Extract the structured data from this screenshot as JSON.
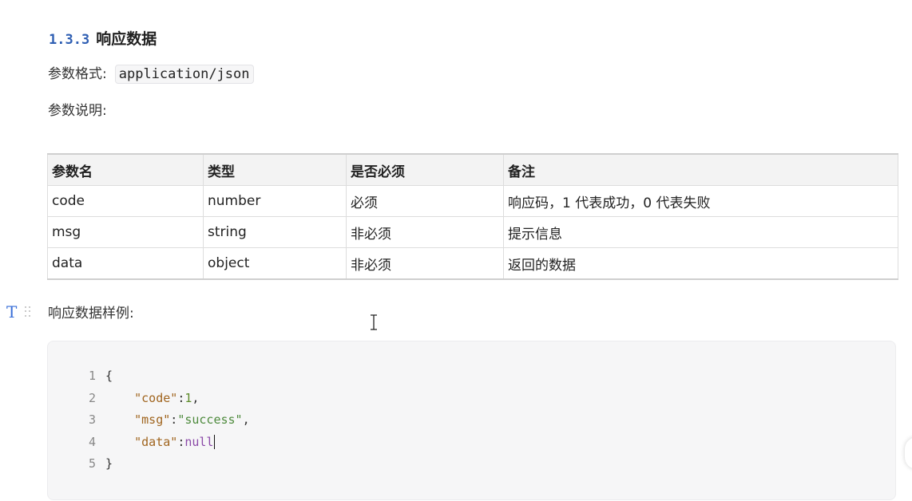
{
  "section": {
    "number": "1.3.3",
    "title": "响应数据"
  },
  "format": {
    "label": "参数格式:",
    "value": "application/json"
  },
  "description_label": "参数说明:",
  "table": {
    "headers": [
      "参数名",
      "类型",
      "是否必须",
      "备注"
    ],
    "rows": [
      [
        "code",
        "number",
        "必须",
        "响应码，1 代表成功，0 代表失败"
      ],
      [
        "msg",
        "string",
        "非必须",
        "提示信息"
      ],
      [
        "data",
        "object",
        "非必须",
        "返回的数据"
      ]
    ]
  },
  "block_toolbar": {
    "type_icon": "T",
    "type_icon_name": "text-type-icon",
    "drag_icon_name": "drag-handle-icon"
  },
  "example_label": "响应数据样例:",
  "code": {
    "lines": [
      {
        "n": "1",
        "indent": "",
        "parts": [
          {
            "t": "punc",
            "v": "{"
          }
        ]
      },
      {
        "n": "2",
        "indent": "    ",
        "parts": [
          {
            "t": "key",
            "v": "\"code\""
          },
          {
            "t": "punc",
            "v": ":"
          },
          {
            "t": "num",
            "v": "1"
          },
          {
            "t": "punc",
            "v": ","
          }
        ]
      },
      {
        "n": "3",
        "indent": "    ",
        "parts": [
          {
            "t": "key",
            "v": "\"msg\""
          },
          {
            "t": "punc",
            "v": ":"
          },
          {
            "t": "str",
            "v": "\"success\""
          },
          {
            "t": "punc",
            "v": ","
          }
        ]
      },
      {
        "n": "4",
        "indent": "    ",
        "parts": [
          {
            "t": "key",
            "v": "\"data\""
          },
          {
            "t": "punc",
            "v": ":"
          },
          {
            "t": "null",
            "v": "null"
          }
        ],
        "caret": true
      },
      {
        "n": "5",
        "indent": "",
        "parts": [
          {
            "t": "punc",
            "v": "}"
          }
        ]
      }
    ]
  },
  "colors": {
    "section_number": "#2f5fb3",
    "json_key": "#a0651f",
    "json_string": "#4d8a3c",
    "json_number": "#5d8b2a",
    "json_null": "#8b4aa8"
  }
}
